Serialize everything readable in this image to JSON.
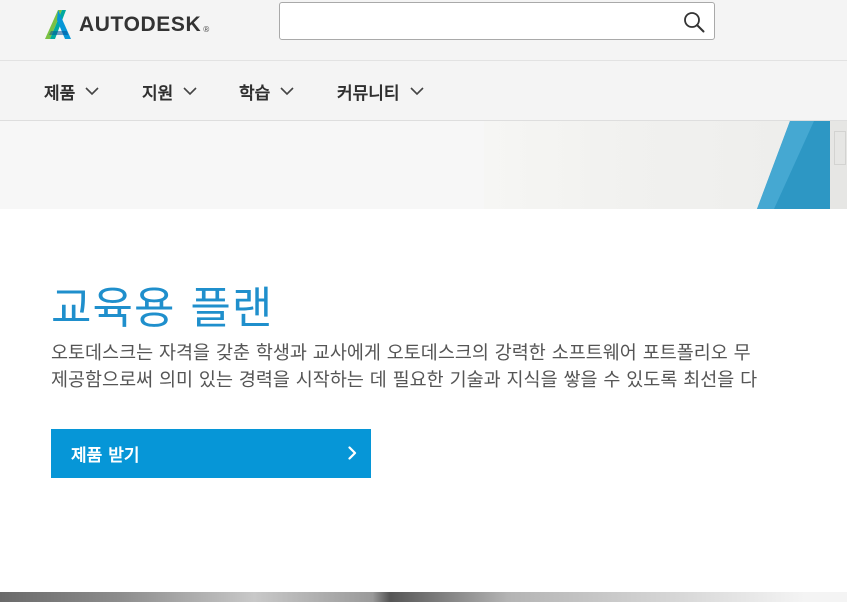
{
  "header": {
    "logo_text": "AUTODESK",
    "logo_reg": "®",
    "search": {
      "value": "",
      "placeholder": ""
    }
  },
  "nav": {
    "items": [
      {
        "label": "제품"
      },
      {
        "label": "지원"
      },
      {
        "label": "학습"
      },
      {
        "label": "커뮤니티"
      }
    ]
  },
  "hero": {
    "title": "교육용 플랜",
    "description_line1": "오토데스크는 자격을 갖춘 학생과 교사에게 오토데스크의 강력한 소프트웨어 포트폴리오 무",
    "description_line2": "제공함으로써 의미 있는 경력을 시작하는 데 필요한 기술과 지식을 쌓을 수 있도록 최선을 다",
    "cta_label": "제품 받기"
  },
  "colors": {
    "accent": "#0696d7",
    "title": "#1f8fcc",
    "header_bg": "#f4f4f4"
  },
  "icons": {
    "logo": "autodesk-logo-icon",
    "search": "search-icon",
    "nav_chevron": "chevron-down-icon",
    "cta_arrow": "chevron-right-icon"
  }
}
